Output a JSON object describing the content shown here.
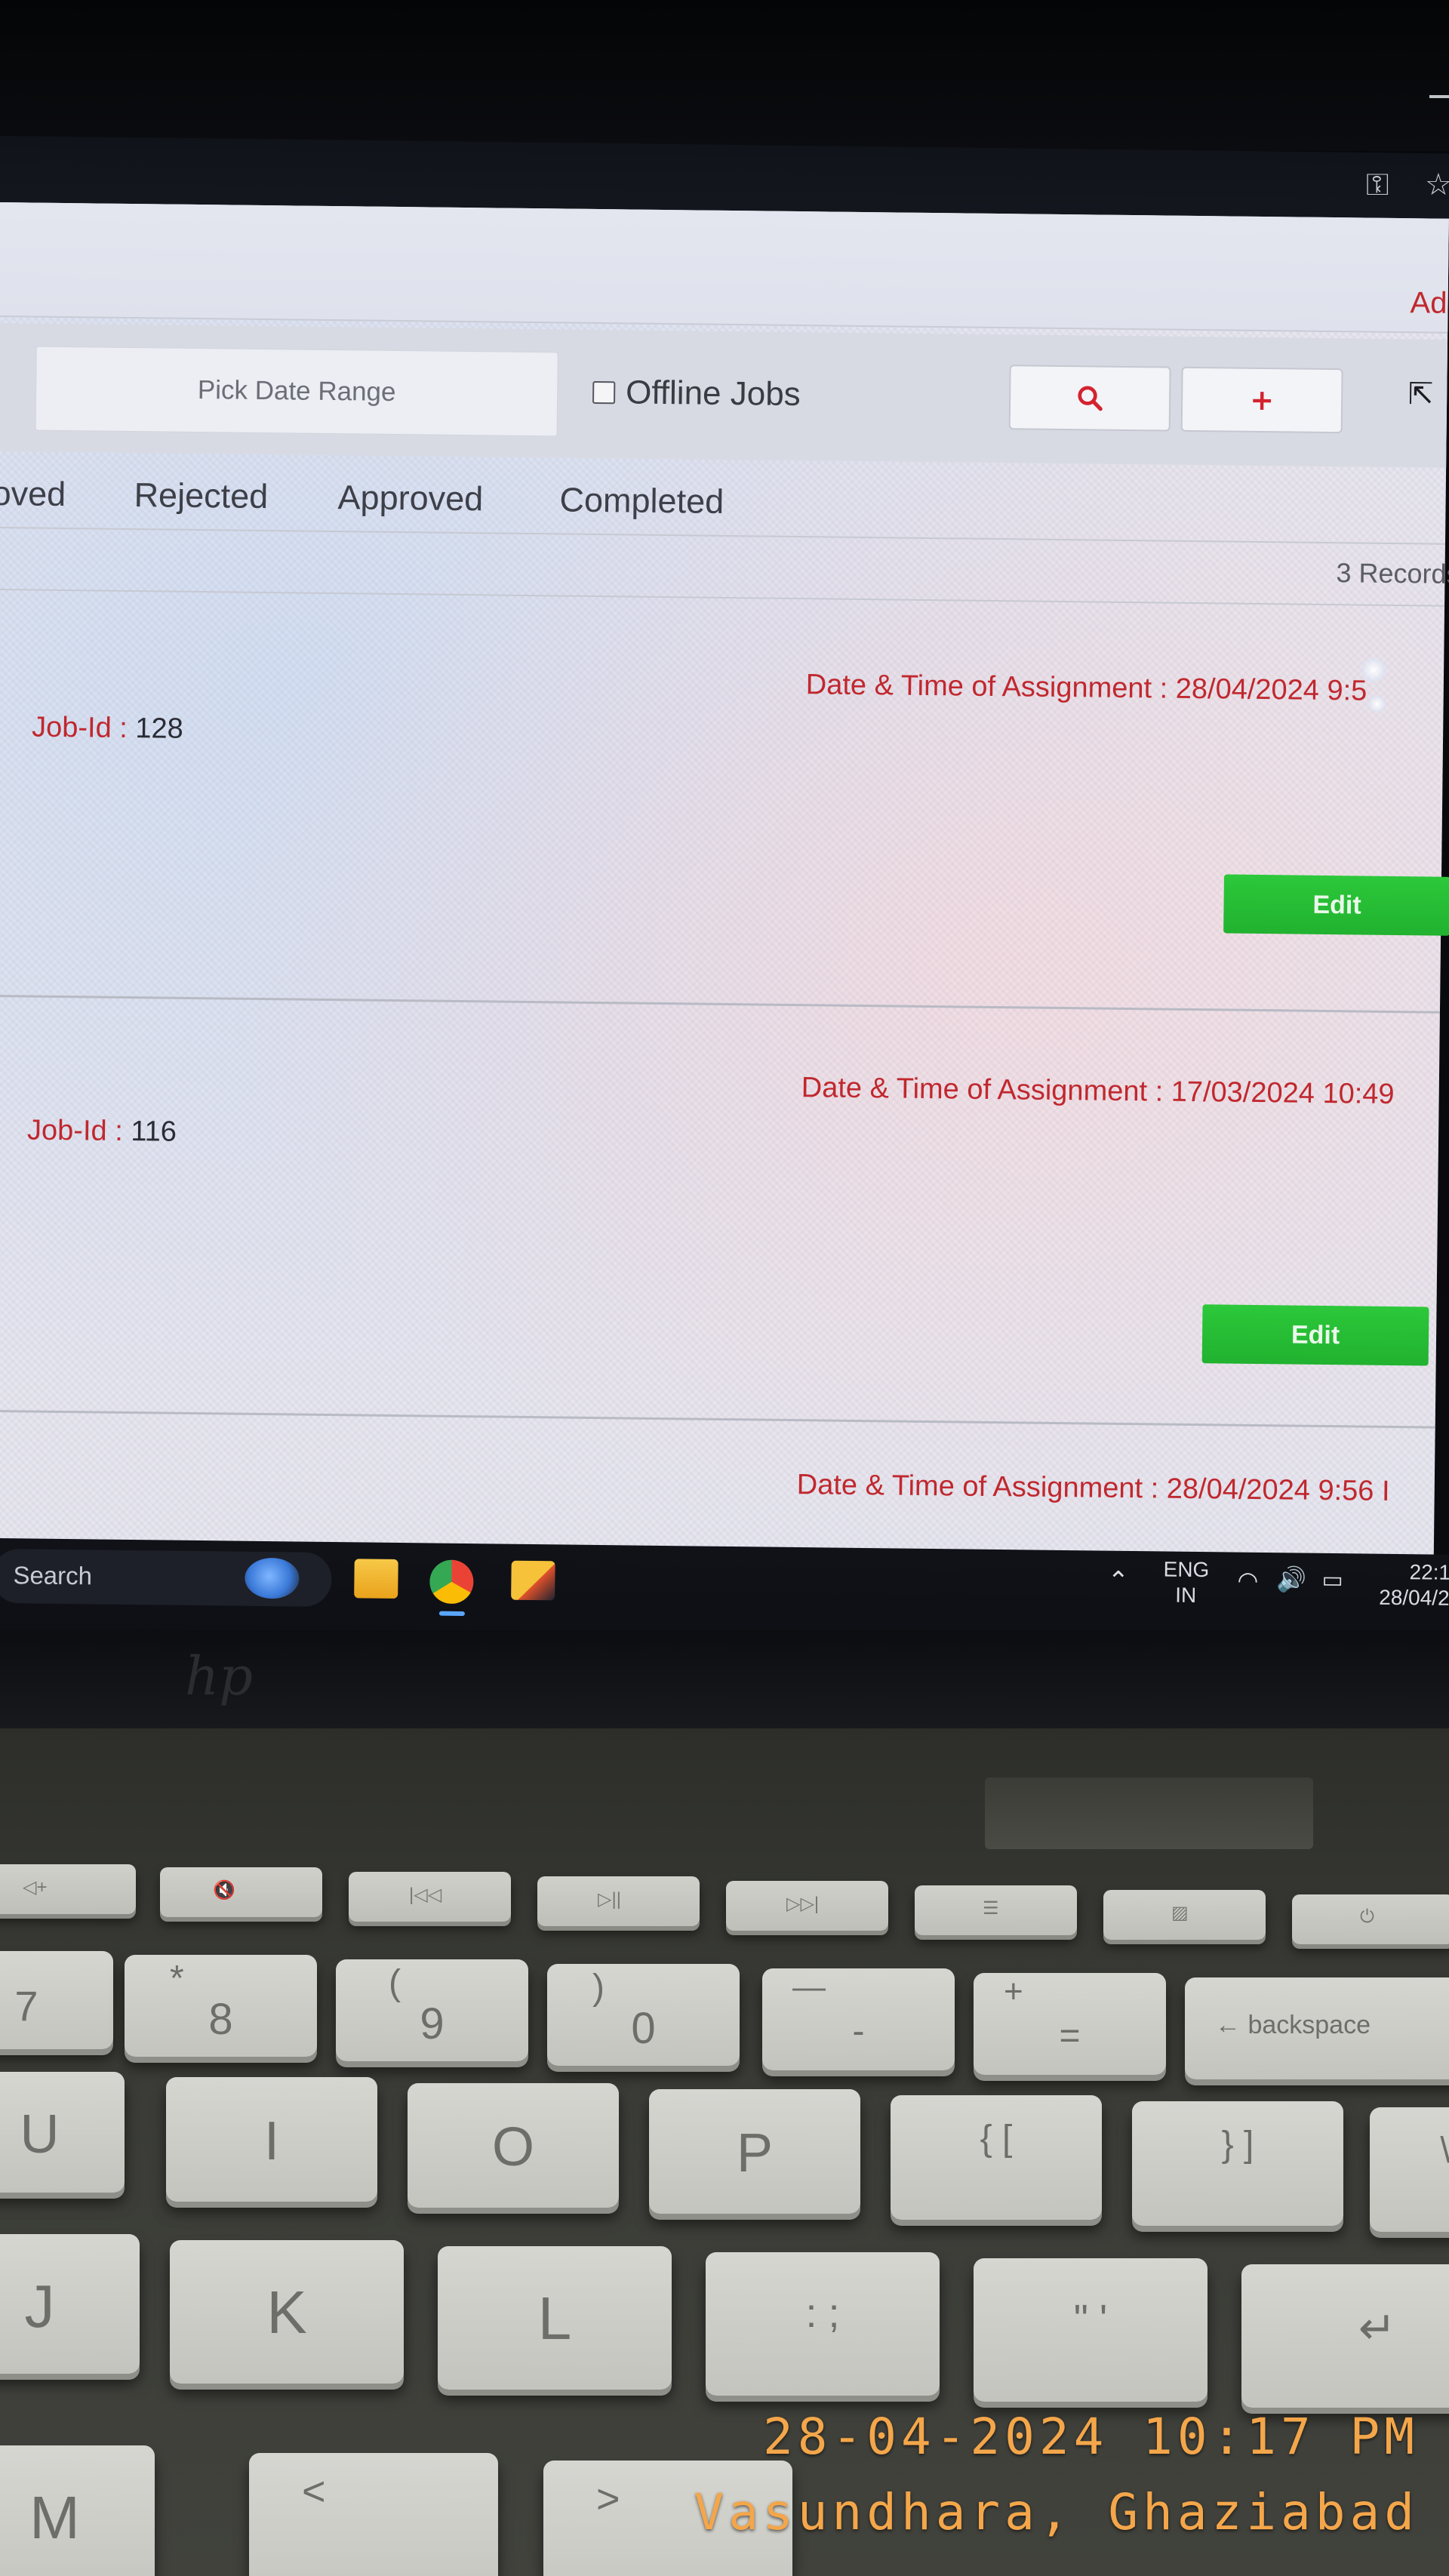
{
  "nav": {
    "admin_partial": "Adı"
  },
  "filters": {
    "date_range_placeholder": "Pick Date Range",
    "offline_jobs_label": "Offline Jobs",
    "offline_jobs_checked": false,
    "search_button_icon": "search-icon",
    "add_button_label": "+"
  },
  "tabs": [
    {
      "label": "oved"
    },
    {
      "label": "Rejected"
    },
    {
      "label": "Approved"
    },
    {
      "label": "Completed"
    }
  ],
  "records_label": "3 Records",
  "jobs": [
    {
      "job_id_label": "Job-Id :",
      "job_id_value": "128",
      "assignment": "Date & Time of Assignment : 28/04/2024 9:5",
      "edit_label": "Edit"
    },
    {
      "job_id_label": "Job-Id :",
      "job_id_value": "116",
      "assignment": "Date & Time of Assignment : 17/03/2024 10:49",
      "edit_label": "Edit"
    },
    {
      "assignment": "Date & Time of Assignment : 28/04/2024 9:56 I"
    }
  ],
  "taskbar": {
    "search_label": "Search",
    "language_top": "ENG",
    "language_bottom": "IN",
    "time": "22:1",
    "date": "28/04/2"
  },
  "keyboard": {
    "number_row": [
      {
        "top": "",
        "bottom": "7"
      },
      {
        "top": "*",
        "bottom": "8"
      },
      {
        "top": "(",
        "bottom": "9"
      },
      {
        "top": ")",
        "bottom": "0"
      },
      {
        "top": "—",
        "bottom": "-"
      },
      {
        "top": "+",
        "bottom": "="
      },
      {
        "top": "",
        "bottom": "← backspace"
      }
    ],
    "letter_row_1": [
      "U",
      "I",
      "O",
      "P",
      "{ [",
      "} ]",
      "\\"
    ],
    "letter_row_2": [
      "J",
      "K",
      "L",
      ": ;",
      "\" '",
      "↵"
    ],
    "letter_row_3": [
      "M",
      "<",
      ">"
    ],
    "function_row": [
      "◁+",
      "🔇",
      "|◁◁",
      "▷||",
      "▷▷|",
      "☰",
      "▨",
      "⏻"
    ]
  },
  "photo_stamp": {
    "datetime": "28-04-2024 10:17 PM",
    "location": "Vasundhara, Ghaziabad"
  },
  "colors": {
    "accent_red": "#c0282e",
    "edit_green": "#21b22f",
    "stamp_orange": "#f4a64a"
  }
}
